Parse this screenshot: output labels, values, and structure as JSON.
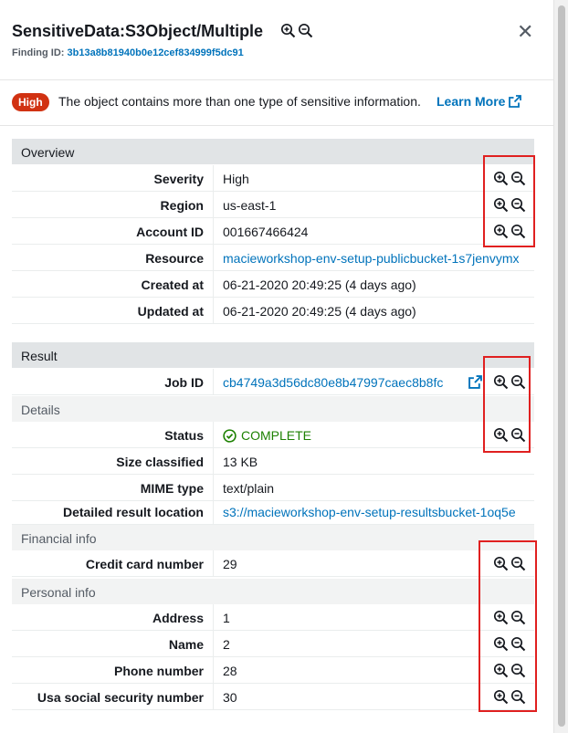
{
  "header": {
    "title": "SensitiveData:S3Object/Multiple",
    "finding_label": "Finding ID:",
    "finding_id": "3b13a8b81940b0e12cef834999f5dc91",
    "close_glyph": "✕"
  },
  "alert": {
    "severity_badge": "High",
    "message": "The object contains more than one type of sensitive information.",
    "learn_more": "Learn More"
  },
  "overview": {
    "heading": "Overview",
    "rows": [
      {
        "key": "Severity",
        "value": "High"
      },
      {
        "key": "Region",
        "value": "us-east-1"
      },
      {
        "key": "Account ID",
        "value": "001667466424"
      },
      {
        "key": "Resource",
        "value": "macieworkshop-env-setup-publicbucket-1s7jenvymx"
      },
      {
        "key": "Created at",
        "value": "06-21-2020 20:49:25 (4 days ago)"
      },
      {
        "key": "Updated at",
        "value": "06-21-2020 20:49:25 (4 days ago)"
      }
    ]
  },
  "result": {
    "heading": "Result",
    "job_id_key": "Job ID",
    "job_id_value": "cb4749a3d56dc80e8b47997caec8b8fc"
  },
  "details": {
    "heading": "Details",
    "rows": [
      {
        "key": "Status",
        "value": "COMPLETE"
      },
      {
        "key": "Size classified",
        "value": "13 KB"
      },
      {
        "key": "MIME type",
        "value": "text/plain"
      },
      {
        "key": "Detailed result location",
        "value": "s3://macieworkshop-env-setup-resultsbucket-1oq5e"
      }
    ]
  },
  "financial": {
    "heading": "Financial info",
    "rows": [
      {
        "key": "Credit card number",
        "value": "29"
      }
    ]
  },
  "personal": {
    "heading": "Personal info",
    "rows": [
      {
        "key": "Address",
        "value": "1"
      },
      {
        "key": "Name",
        "value": "2"
      },
      {
        "key": "Phone number",
        "value": "28"
      },
      {
        "key": "Usa social security number",
        "value": "30"
      }
    ]
  },
  "colors": {
    "link": "#0073bb",
    "badge": "#d13212",
    "status_ok": "#1d8102",
    "highlight_box": "#e02020",
    "section_header": "#e1e4e6"
  },
  "icons": [
    "zoom-in-icon",
    "zoom-out-icon",
    "close-icon",
    "external-link-icon",
    "check-circle-icon"
  ]
}
